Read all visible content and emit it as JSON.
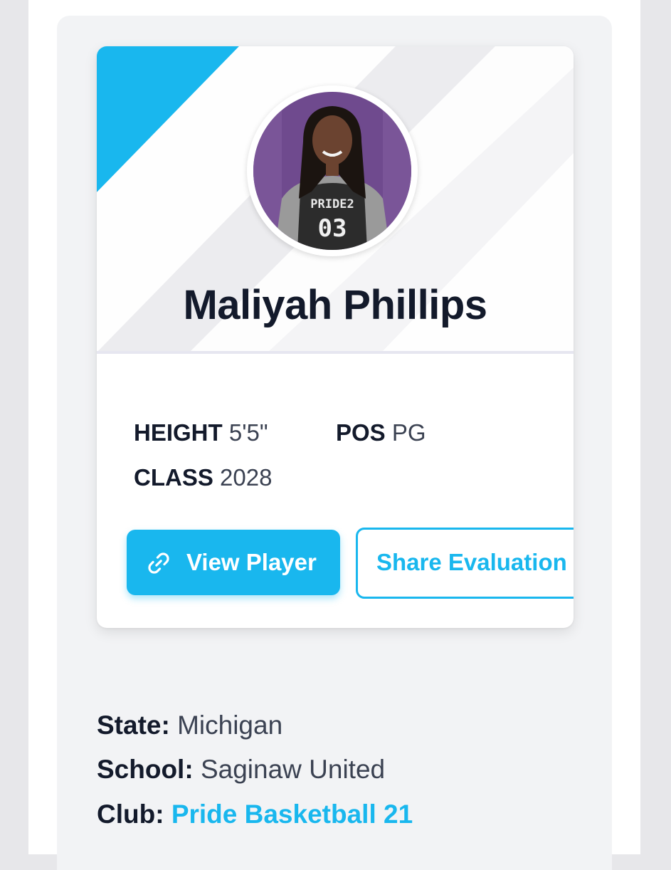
{
  "player": {
    "name": "Maliyah Phillips",
    "jersey_text": "PRIDE2",
    "jersey_number": "03"
  },
  "stats": {
    "height_label": "HEIGHT",
    "height_value": "5'5\"",
    "pos_label": "POS",
    "pos_value": "PG",
    "class_label": "CLASS",
    "class_value": "2028"
  },
  "actions": {
    "view_player_label": "View Player",
    "view_player_icon": "link-icon",
    "share_label": "Share Evaluation"
  },
  "details": {
    "state_label": "State:",
    "state_value": "Michigan",
    "school_label": "School:",
    "school_value": "Saginaw United",
    "club_label": "Club:",
    "club_value": "Pride Basketball 21"
  },
  "colors": {
    "accent": "#19b7ee",
    "heading": "#131a2b",
    "text": "#3b4252",
    "photo_background": "#6f4a8e"
  }
}
